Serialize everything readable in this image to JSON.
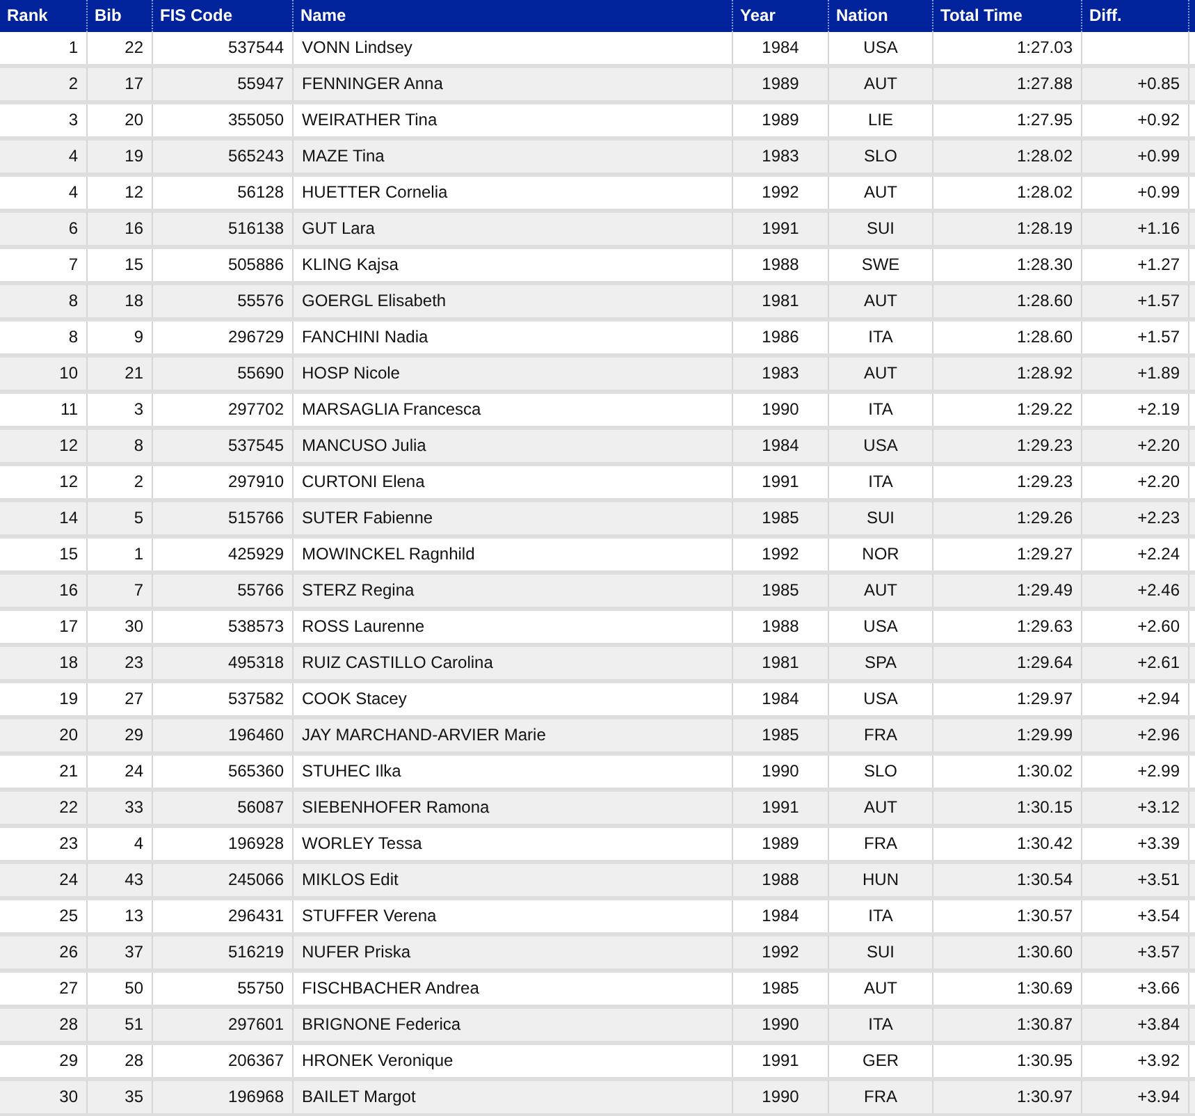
{
  "table": {
    "columns": [
      "Rank",
      "Bib",
      "FIS Code",
      "Name",
      "Year",
      "Nation",
      "Total Time",
      "Diff."
    ],
    "rows": [
      {
        "rank": "1",
        "bib": "22",
        "fis_code": "537544",
        "name": "VONN Lindsey",
        "year": "1984",
        "nation": "USA",
        "total_time": "1:27.03"
      },
      {
        "rank": "2",
        "bib": "17",
        "fis_code": "55947",
        "name": "FENNINGER Anna",
        "year": "1989",
        "nation": "AUT",
        "total_time": "1:27.88",
        "diff": "+0.85"
      },
      {
        "rank": "3",
        "bib": "20",
        "fis_code": "355050",
        "name": "WEIRATHER Tina",
        "year": "1989",
        "nation": "LIE",
        "total_time": "1:27.95",
        "diff": "+0.92"
      },
      {
        "rank": "4",
        "bib": "19",
        "fis_code": "565243",
        "name": "MAZE Tina",
        "year": "1983",
        "nation": "SLO",
        "total_time": "1:28.02",
        "diff": "+0.99"
      },
      {
        "rank": "4",
        "bib": "12",
        "fis_code": "56128",
        "name": "HUETTER Cornelia",
        "year": "1992",
        "nation": "AUT",
        "total_time": "1:28.02",
        "diff": "+0.99"
      },
      {
        "rank": "6",
        "bib": "16",
        "fis_code": "516138",
        "name": "GUT Lara",
        "year": "1991",
        "nation": "SUI",
        "total_time": "1:28.19",
        "diff": "+1.16"
      },
      {
        "rank": "7",
        "bib": "15",
        "fis_code": "505886",
        "name": "KLING Kajsa",
        "year": "1988",
        "nation": "SWE",
        "total_time": "1:28.30",
        "diff": "+1.27"
      },
      {
        "rank": "8",
        "bib": "18",
        "fis_code": "55576",
        "name": "GOERGL Elisabeth",
        "year": "1981",
        "nation": "AUT",
        "total_time": "1:28.60",
        "diff": "+1.57"
      },
      {
        "rank": "8",
        "bib": "9",
        "fis_code": "296729",
        "name": "FANCHINI Nadia",
        "year": "1986",
        "nation": "ITA",
        "total_time": "1:28.60",
        "diff": "+1.57"
      },
      {
        "rank": "10",
        "bib": "21",
        "fis_code": "55690",
        "name": "HOSP Nicole",
        "year": "1983",
        "nation": "AUT",
        "total_time": "1:28.92",
        "diff": "+1.89"
      },
      {
        "rank": "11",
        "bib": "3",
        "fis_code": "297702",
        "name": "MARSAGLIA Francesca",
        "year": "1990",
        "nation": "ITA",
        "total_time": "1:29.22",
        "diff": "+2.19"
      },
      {
        "rank": "12",
        "bib": "8",
        "fis_code": "537545",
        "name": "MANCUSO Julia",
        "year": "1984",
        "nation": "USA",
        "total_time": "1:29.23",
        "diff": "+2.20"
      },
      {
        "rank": "12",
        "bib": "2",
        "fis_code": "297910",
        "name": "CURTONI Elena",
        "year": "1991",
        "nation": "ITA",
        "total_time": "1:29.23",
        "diff": "+2.20"
      },
      {
        "rank": "14",
        "bib": "5",
        "fis_code": "515766",
        "name": "SUTER Fabienne",
        "year": "1985",
        "nation": "SUI",
        "total_time": "1:29.26",
        "diff": "+2.23"
      },
      {
        "rank": "15",
        "bib": "1",
        "fis_code": "425929",
        "name": "MOWINCKEL Ragnhild",
        "year": "1992",
        "nation": "NOR",
        "total_time": "1:29.27",
        "diff": "+2.24"
      },
      {
        "rank": "16",
        "bib": "7",
        "fis_code": "55766",
        "name": "STERZ Regina",
        "year": "1985",
        "nation": "AUT",
        "total_time": "1:29.49",
        "diff": "+2.46"
      },
      {
        "rank": "17",
        "bib": "30",
        "fis_code": "538573",
        "name": "ROSS Laurenne",
        "year": "1988",
        "nation": "USA",
        "total_time": "1:29.63",
        "diff": "+2.60"
      },
      {
        "rank": "18",
        "bib": "23",
        "fis_code": "495318",
        "name": "RUIZ CASTILLO Carolina",
        "year": "1981",
        "nation": "SPA",
        "total_time": "1:29.64",
        "diff": "+2.61"
      },
      {
        "rank": "19",
        "bib": "27",
        "fis_code": "537582",
        "name": "COOK Stacey",
        "year": "1984",
        "nation": "USA",
        "total_time": "1:29.97",
        "diff": "+2.94"
      },
      {
        "rank": "20",
        "bib": "29",
        "fis_code": "196460",
        "name": "JAY MARCHAND-ARVIER Marie",
        "year": "1985",
        "nation": "FRA",
        "total_time": "1:29.99",
        "diff": "+2.96"
      },
      {
        "rank": "21",
        "bib": "24",
        "fis_code": "565360",
        "name": "STUHEC Ilka",
        "year": "1990",
        "nation": "SLO",
        "total_time": "1:30.02",
        "diff": "+2.99"
      },
      {
        "rank": "22",
        "bib": "33",
        "fis_code": "56087",
        "name": "SIEBENHOFER Ramona",
        "year": "1991",
        "nation": "AUT",
        "total_time": "1:30.15",
        "diff": "+3.12"
      },
      {
        "rank": "23",
        "bib": "4",
        "fis_code": "196928",
        "name": "WORLEY Tessa",
        "year": "1989",
        "nation": "FRA",
        "total_time": "1:30.42",
        "diff": "+3.39"
      },
      {
        "rank": "24",
        "bib": "43",
        "fis_code": "245066",
        "name": "MIKLOS Edit",
        "year": "1988",
        "nation": "HUN",
        "total_time": "1:30.54",
        "diff": "+3.51"
      },
      {
        "rank": "25",
        "bib": "13",
        "fis_code": "296431",
        "name": "STUFFER Verena",
        "year": "1984",
        "nation": "ITA",
        "total_time": "1:30.57",
        "diff": "+3.54"
      },
      {
        "rank": "26",
        "bib": "37",
        "fis_code": "516219",
        "name": "NUFER Priska",
        "year": "1992",
        "nation": "SUI",
        "total_time": "1:30.60",
        "diff": "+3.57"
      },
      {
        "rank": "27",
        "bib": "50",
        "fis_code": "55750",
        "name": "FISCHBACHER Andrea",
        "year": "1985",
        "nation": "AUT",
        "total_time": "1:30.69",
        "diff": "+3.66"
      },
      {
        "rank": "28",
        "bib": "51",
        "fis_code": "297601",
        "name": "BRIGNONE Federica",
        "year": "1990",
        "nation": "ITA",
        "total_time": "1:30.87",
        "diff": "+3.84"
      },
      {
        "rank": "29",
        "bib": "28",
        "fis_code": "206367",
        "name": "HRONEK Veronique",
        "year": "1991",
        "nation": "GER",
        "total_time": "1:30.95",
        "diff": "+3.92"
      },
      {
        "rank": "30",
        "bib": "35",
        "fis_code": "196968",
        "name": "BAILET Margot",
        "year": "1990",
        "nation": "FRA",
        "total_time": "1:30.97",
        "diff": "+3.94"
      }
    ]
  }
}
